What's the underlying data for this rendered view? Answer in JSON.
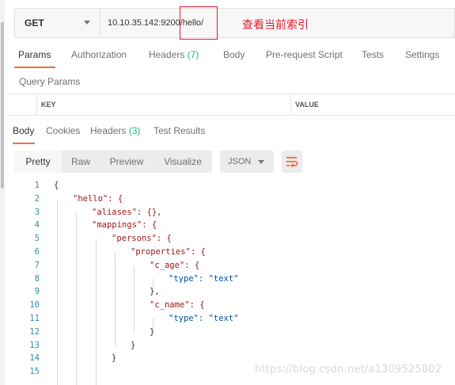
{
  "request": {
    "method": "GET",
    "url": "10.10.35.142:9200/hello/",
    "annotation": "查看当前索引"
  },
  "request_tabs": [
    {
      "label": "Params"
    },
    {
      "label": "Authorization"
    },
    {
      "label": "Headers",
      "count": "(7)"
    },
    {
      "label": "Body"
    },
    {
      "label": "Pre-request Script"
    },
    {
      "label": "Tests"
    },
    {
      "label": "Settings"
    }
  ],
  "query_params": {
    "title": "Query Params",
    "key_header": "KEY",
    "value_header": "VALUE"
  },
  "response_tabs": [
    {
      "label": "Body"
    },
    {
      "label": "Cookies"
    },
    {
      "label": "Headers",
      "count": "(3)"
    },
    {
      "label": "Test Results"
    }
  ],
  "view_modes": [
    "Pretty",
    "Raw",
    "Preview",
    "Visualize"
  ],
  "format": "JSON",
  "code_lines": [
    {
      "n": "1",
      "text": "{"
    },
    {
      "n": "2",
      "text": "\"hello\": {"
    },
    {
      "n": "3",
      "text": "\"aliases\": {},"
    },
    {
      "n": "4",
      "text": "\"mappings\": {"
    },
    {
      "n": "5",
      "text": "\"persons\": {"
    },
    {
      "n": "6",
      "text": "\"properties\": {"
    },
    {
      "n": "7",
      "text": "\"c_age\": {"
    },
    {
      "n": "8",
      "text": "\"type\": \"text\""
    },
    {
      "n": "9",
      "text": "},"
    },
    {
      "n": "10",
      "text": "\"c_name\": {"
    },
    {
      "n": "11",
      "text": "\"type\": \"text\""
    },
    {
      "n": "12",
      "text": "}"
    },
    {
      "n": "13",
      "text": "}"
    },
    {
      "n": "14",
      "text": "}"
    },
    {
      "n": "15",
      "text": ""
    }
  ],
  "watermark": "https://blog.csdn.net/a1309525802",
  "colors": {
    "accent": "#f26b3a",
    "annotation": "#e8192c",
    "count": "#26b47f",
    "json_key": "#a31515",
    "json_string": "#0451a5",
    "line_number": "#2d8bb6"
  }
}
